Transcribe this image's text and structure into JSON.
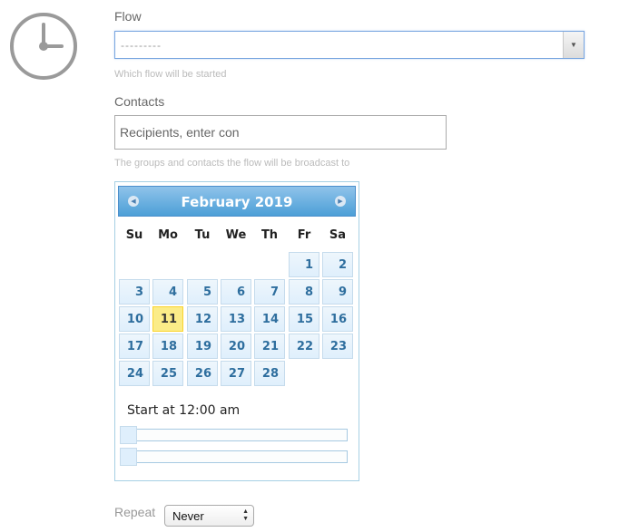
{
  "flow": {
    "label": "Flow",
    "value": "---------",
    "help": "Which flow will be started"
  },
  "contacts": {
    "label": "Contacts",
    "placeholder": "Recipients, enter con",
    "help": "The groups and contacts the flow will be broadcast to"
  },
  "calendar": {
    "title": "February 2019",
    "weekdays": [
      "Su",
      "Mo",
      "Tu",
      "We",
      "Th",
      "Fr",
      "Sa"
    ],
    "today": "11",
    "weeks": [
      [
        "",
        "",
        "",
        "",
        "",
        "1",
        "2"
      ],
      [
        "3",
        "4",
        "5",
        "6",
        "7",
        "8",
        "9"
      ],
      [
        "10",
        "11",
        "12",
        "13",
        "14",
        "15",
        "16"
      ],
      [
        "17",
        "18",
        "19",
        "20",
        "21",
        "22",
        "23"
      ],
      [
        "24",
        "25",
        "26",
        "27",
        "28",
        "",
        ""
      ]
    ],
    "start_text": "Start at 12:00 am",
    "hour_level": 0,
    "minute_level": 0
  },
  "repeat": {
    "label": "Repeat",
    "value": "Never"
  }
}
